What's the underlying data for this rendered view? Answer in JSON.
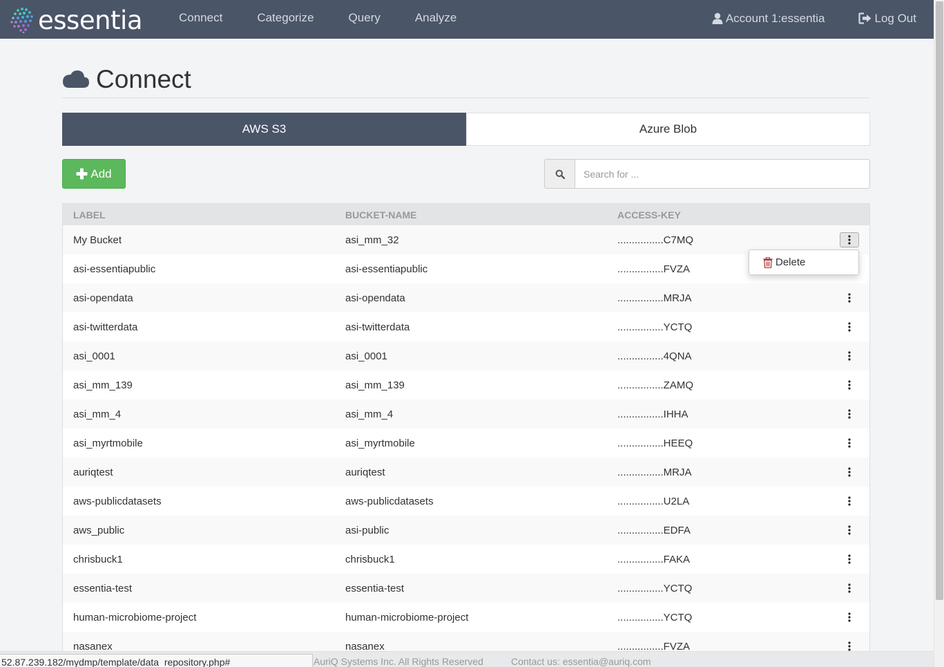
{
  "brand": {
    "name": "essentia"
  },
  "nav": {
    "links": [
      "Connect",
      "Categorize",
      "Query",
      "Analyze"
    ],
    "account": "Account 1:essentia",
    "logout": "Log Out"
  },
  "page": {
    "title": "Connect"
  },
  "tabs": [
    {
      "label": "AWS S3",
      "active": true
    },
    {
      "label": "Azure Blob",
      "active": false
    }
  ],
  "toolbar": {
    "add_label": "Add",
    "search_placeholder": "Search for ..."
  },
  "table": {
    "columns": [
      "LABEL",
      "BUCKET-NAME",
      "ACCESS-KEY"
    ],
    "rows": [
      {
        "label": "My Bucket",
        "bucket": "asi_mm_32",
        "key": "................C7MQ"
      },
      {
        "label": "asi-essentiapublic",
        "bucket": "asi-essentiapublic",
        "key": "................FVZA"
      },
      {
        "label": "asi-opendata",
        "bucket": "asi-opendata",
        "key": "................MRJA"
      },
      {
        "label": "asi-twitterdata",
        "bucket": "asi-twitterdata",
        "key": "................YCTQ"
      },
      {
        "label": "asi_0001",
        "bucket": "asi_0001",
        "key": "................4QNA"
      },
      {
        "label": "asi_mm_139",
        "bucket": "asi_mm_139",
        "key": "................ZAMQ"
      },
      {
        "label": "asi_mm_4",
        "bucket": "asi_mm_4",
        "key": "................IHHA"
      },
      {
        "label": "asi_myrtmobile",
        "bucket": "asi_myrtmobile",
        "key": "................HEEQ"
      },
      {
        "label": "auriqtest",
        "bucket": "auriqtest",
        "key": "................MRJA"
      },
      {
        "label": "aws-publicdatasets",
        "bucket": "aws-publicdatasets",
        "key": "................U2LA"
      },
      {
        "label": "aws_public",
        "bucket": "asi-public",
        "key": "................EDFA"
      },
      {
        "label": "chrisbuck1",
        "bucket": "chrisbuck1",
        "key": "................FAKA"
      },
      {
        "label": "essentia-test",
        "bucket": "essentia-test",
        "key": "................YCTQ"
      },
      {
        "label": "human-microbiome-project",
        "bucket": "human-microbiome-project",
        "key": "................YCTQ"
      },
      {
        "label": "nasanex",
        "bucket": "nasanex",
        "key": "................FVZA"
      }
    ]
  },
  "dropdown": {
    "delete_label": "Delete"
  },
  "footer": {
    "copyright": "AuriQ Systems Inc. All Rights Reserved",
    "contact": "Contact us: essentia@auriq.com"
  },
  "status_bar": {
    "url": "52.87.239.182/mydmp/template/data_repository.php#"
  },
  "colors": {
    "navbar": "#4a5567",
    "accent_green": "#5cb85c",
    "delete_icon": "#a94442"
  }
}
